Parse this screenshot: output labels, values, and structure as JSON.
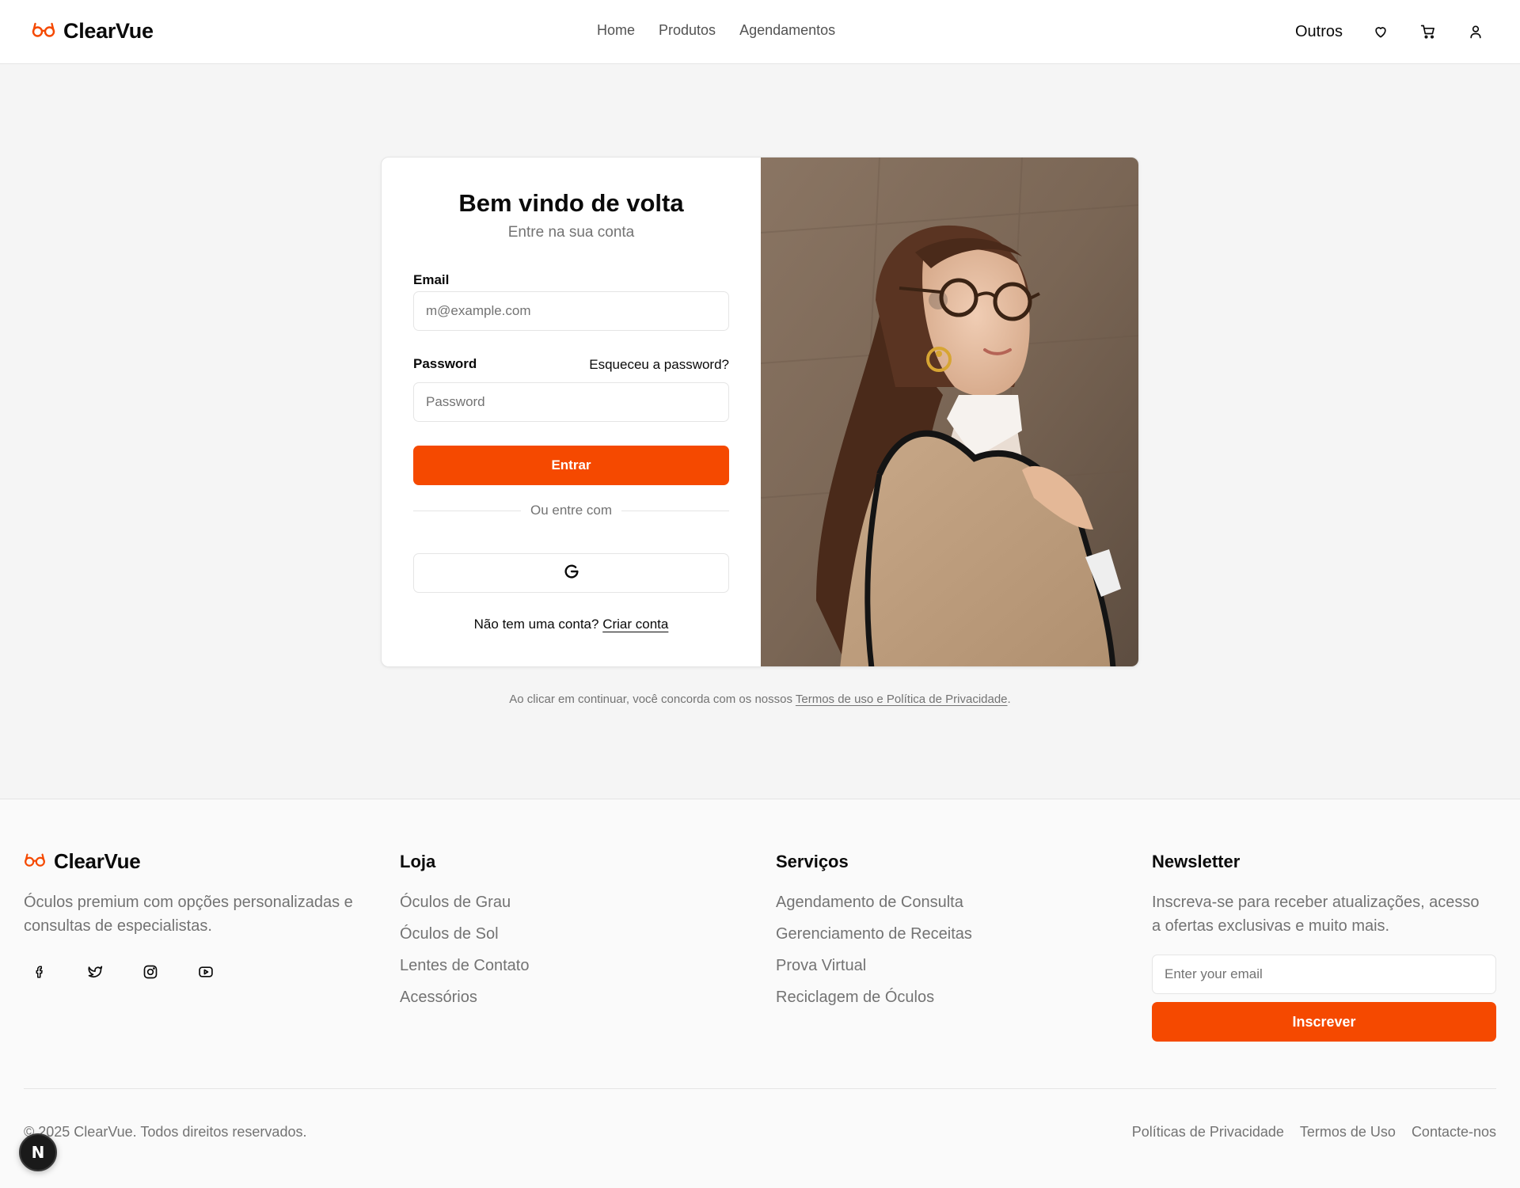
{
  "brand": {
    "name": "ClearVue",
    "accent": "#f54900",
    "logo_icon": "glasses-icon"
  },
  "header": {
    "nav": [
      "Home",
      "Produtos",
      "Agendamentos"
    ],
    "others_label": "Outros",
    "icons": [
      "heart-icon",
      "cart-icon",
      "user-icon"
    ]
  },
  "login": {
    "title": "Bem vindo de volta",
    "subtitle": "Entre na sua conta",
    "email_label": "Email",
    "email_placeholder": "m@example.com",
    "password_label": "Password",
    "forgot_label": "Esqueceu a password?",
    "password_placeholder": "Password",
    "submit_label": "Entrar",
    "divider_label": "Ou entre com",
    "social_icon": "google-icon",
    "no_account_text": "Não tem uma conta?",
    "create_account_label": "Criar conta"
  },
  "terms": {
    "prefix": "Ao clicar em continuar, você concorda com os nossos",
    "link": "Termos de uso e Política de Privacidade",
    "suffix": "."
  },
  "footer": {
    "brand_name": "ClearVue",
    "description": "Óculos premium com opções personalizadas e consultas de especialistas.",
    "social_icons": [
      "facebook-icon",
      "twitter-icon",
      "instagram-icon",
      "youtube-icon"
    ],
    "store": {
      "title": "Loja",
      "items": [
        "Óculos de Grau",
        "Óculos de Sol",
        "Lentes de Contato",
        "Acessórios"
      ]
    },
    "services": {
      "title": "Serviços",
      "items": [
        "Agendamento de Consulta",
        "Gerenciamento de Receitas",
        "Prova Virtual",
        "Reciclagem de Óculos"
      ]
    },
    "newsletter": {
      "title": "Newsletter",
      "text": "Inscreva-se para receber atualizações, acesso a ofertas exclusivas e muito mais.",
      "placeholder": "Enter your email",
      "button_label": "Inscrever"
    },
    "copyright": "© 2025 ClearVue. Todos direitos reservados.",
    "legal_links": [
      "Políticas de Privacidade",
      "Termos de Uso",
      "Contacte-nos"
    ]
  },
  "dev_badge": "N"
}
